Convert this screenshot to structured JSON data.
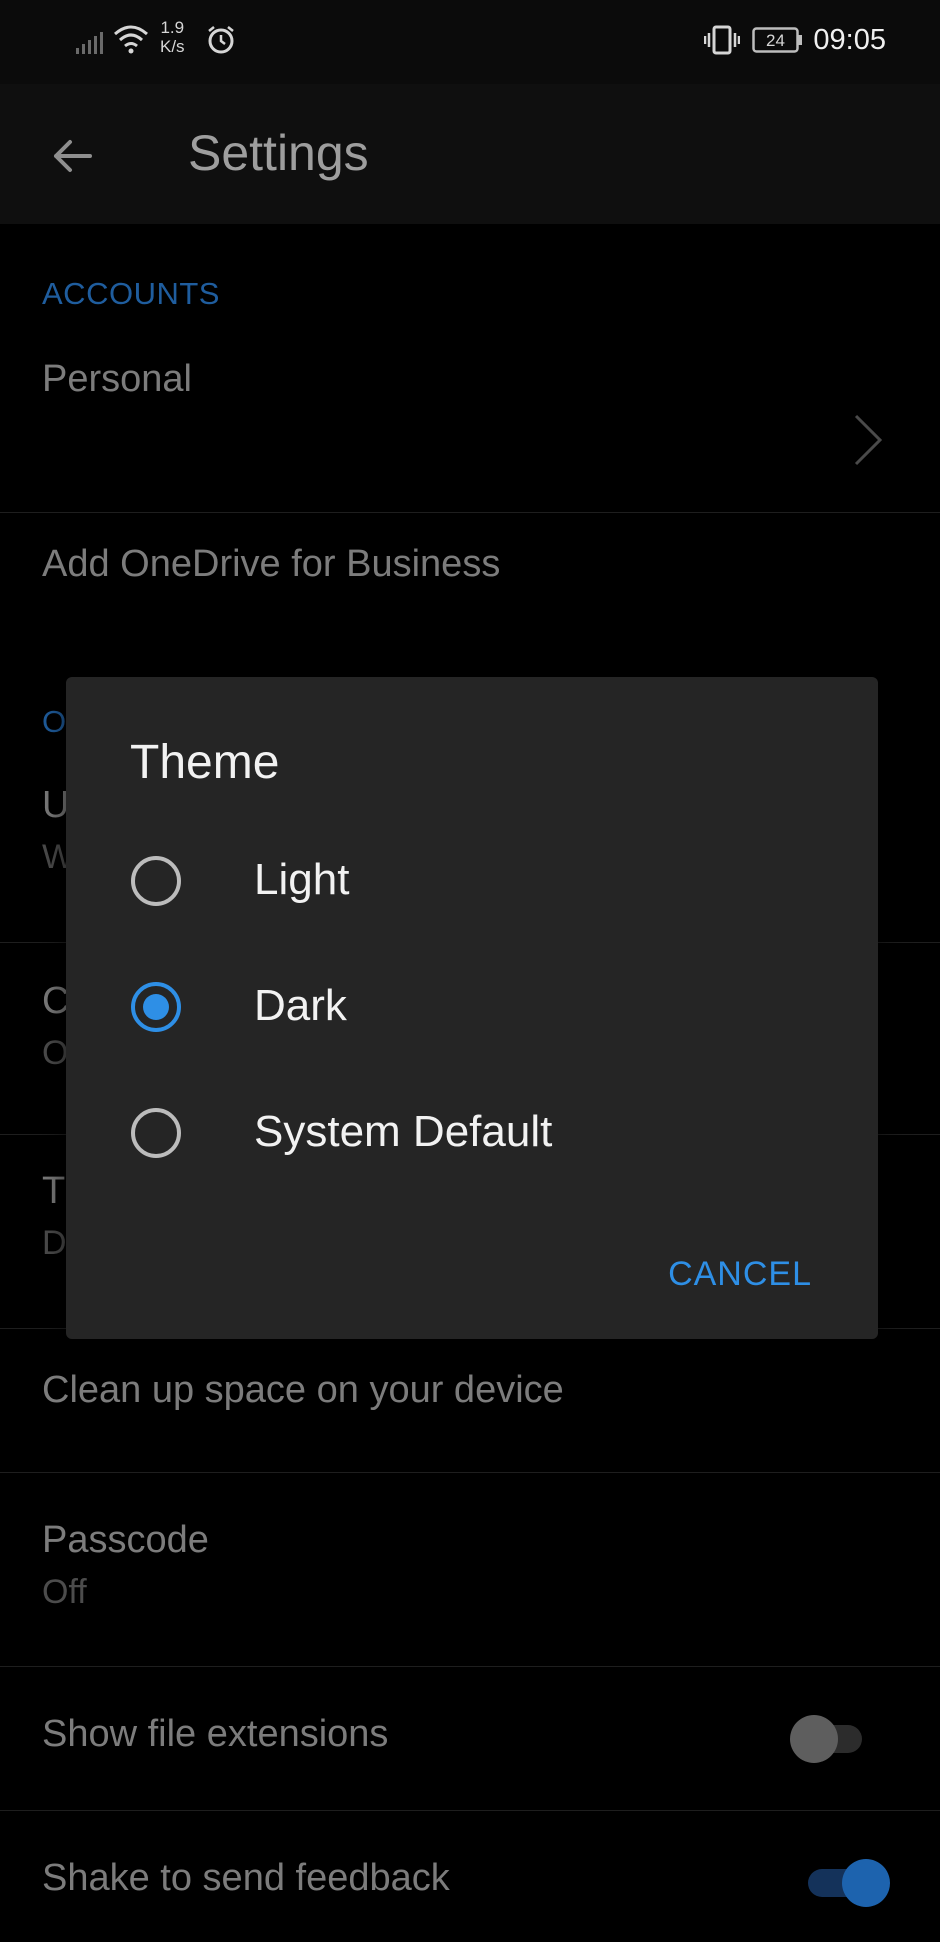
{
  "status_bar": {
    "net_speed_value": "1.9",
    "net_speed_unit": "K/s",
    "battery": "24",
    "time": "09:05",
    "icons": [
      "signal-icon",
      "wifi-icon",
      "alarm-icon",
      "vibrate-icon",
      "battery-icon"
    ]
  },
  "app_bar": {
    "title": "Settings",
    "back_icon": "arrow-left-icon"
  },
  "list": {
    "accounts_header": "ACCOUNTS",
    "personal_label": "Personal",
    "add_business_label": "Add OneDrive for Business",
    "hidden_header_fragment": "O",
    "hidden_row1_primary": "U",
    "hidden_row1_secondary": "W",
    "hidden_row2_primary": "C",
    "hidden_row2_secondary": "O",
    "hidden_row3_primary": "T",
    "hidden_row3_secondary": "D",
    "clean_up_label": "Clean up space on your device",
    "passcode_label": "Passcode",
    "passcode_value": "Off",
    "show_extensions_label": "Show file extensions",
    "show_extensions_on": false,
    "shake_feedback_label": "Shake to send feedback",
    "shake_feedback_on": true
  },
  "dialog": {
    "title": "Theme",
    "options": [
      {
        "label": "Light",
        "selected": false
      },
      {
        "label": "Dark",
        "selected": true
      },
      {
        "label": "System Default",
        "selected": false
      }
    ],
    "cancel_label": "CANCEL"
  },
  "colors": {
    "accent": "#2e8fe6",
    "section_header": "#1f5d9e",
    "dialog_bg": "#252525",
    "background": "#000000"
  }
}
